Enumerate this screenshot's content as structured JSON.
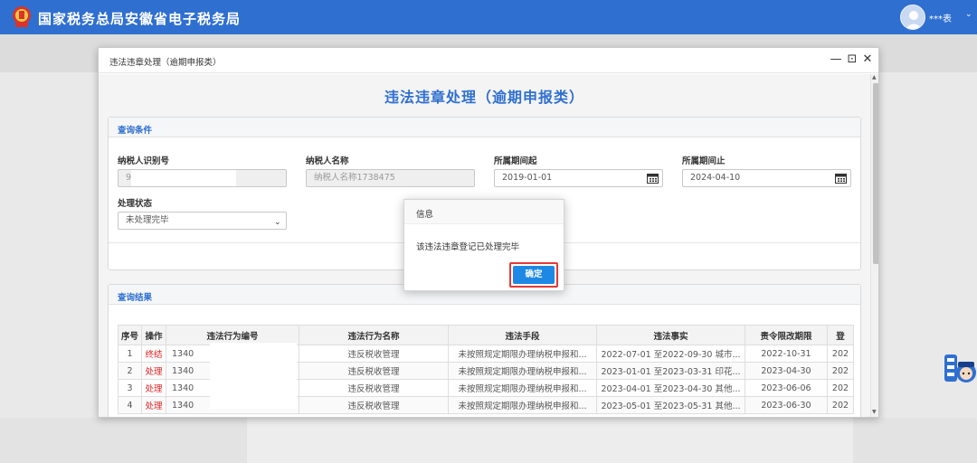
{
  "app": {
    "title": "国家税务总局安徽省电子税务局",
    "user_name": "***表",
    "user_caret": "⌄"
  },
  "modal": {
    "title": "违法违章处理（逾期申报类）",
    "heading": "违法违章处理（逾期申报类）",
    "controls": {
      "minimize": "—",
      "maximize": "⊡",
      "close": "✕"
    }
  },
  "query": {
    "panel_title": "查询条件",
    "taxpayer_id": {
      "label": "纳税人识别号",
      "value": "9"
    },
    "taxpayer_name": {
      "label": "纳税人名称",
      "placeholder": "纳税人名称1738475"
    },
    "period_start": {
      "label": "所属期间起",
      "value": "2019-01-01"
    },
    "period_end": {
      "label": "所属期间止",
      "value": "2024-04-10"
    },
    "status": {
      "label": "处理状态",
      "value": "未处理完毕"
    }
  },
  "results": {
    "panel_title": "查询结果",
    "columns": [
      "序号",
      "操作",
      "违法行为编号",
      "违法行为名称",
      "违法手段",
      "违法事实",
      "责令限改期限",
      "登"
    ],
    "rows": [
      {
        "no": "1",
        "op": "终结",
        "code": "1340",
        "name": "违反税收管理",
        "means": "未按照规定期限办理纳税申报和...",
        "fact": "2022-07-01 至2022-09-30 城市...",
        "deadline": "2022-10-31",
        "reg": "202"
      },
      {
        "no": "2",
        "op": "处理",
        "code": "1340",
        "name": "违反税收管理",
        "means": "未按照规定期限办理纳税申报和...",
        "fact": "2023-01-01 至2023-03-31 印花...",
        "deadline": "2023-04-30",
        "reg": "202"
      },
      {
        "no": "3",
        "op": "处理",
        "code": "1340",
        "name": "违反税收管理",
        "means": "未按照规定期限办理纳税申报和...",
        "fact": "2023-04-01 至2023-04-30 其他...",
        "deadline": "2023-06-06",
        "reg": "202"
      },
      {
        "no": "4",
        "op": "处理",
        "code": "1340",
        "name": "违反税收管理",
        "means": "未按照规定期限办理纳税申报和...",
        "fact": "2023-05-01 至2023-05-31 其他...",
        "deadline": "2023-06-30",
        "reg": "202"
      }
    ]
  },
  "dialog": {
    "title": "信息",
    "message": "该违法违章登记已处理完毕",
    "ok_label": "确定"
  },
  "colors": {
    "brand": "#2f6fd0",
    "ok_button": "#1e88e5",
    "highlight": "#e53935",
    "operation_link": "#e02020"
  }
}
